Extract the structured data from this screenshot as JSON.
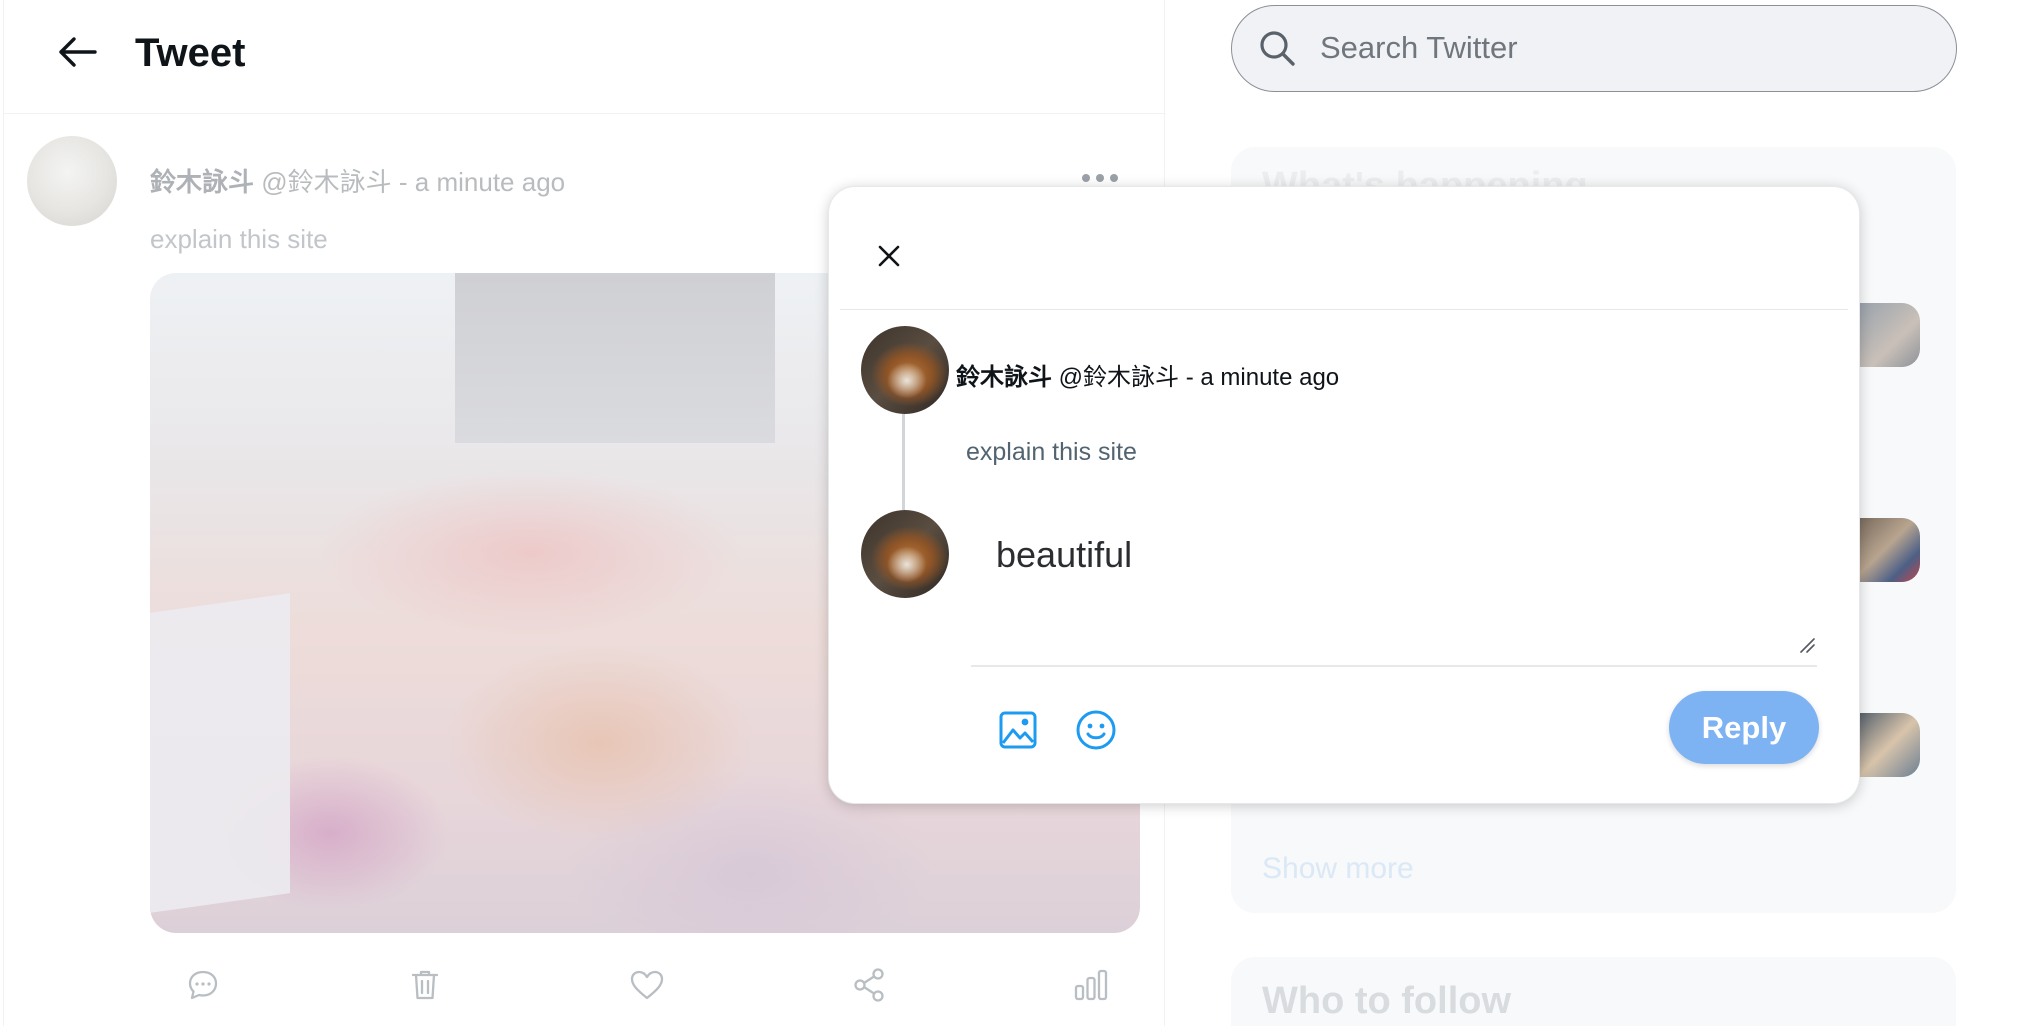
{
  "header": {
    "title": "Tweet"
  },
  "tweet": {
    "author_name": "鈴木詠斗",
    "author_handle": "@鈴木詠斗",
    "separator": "-",
    "timestamp": "a minute ago",
    "text": "explain this site",
    "actions": [
      "comment-icon",
      "trash-icon",
      "heart-icon",
      "share-icon",
      "stats-icon"
    ]
  },
  "search": {
    "placeholder": "Search Twitter"
  },
  "trends": {
    "title": "What's happening",
    "show_more": "Show more"
  },
  "follow": {
    "title": "Who to follow"
  },
  "reply_modal": {
    "original": {
      "author_name": "鈴木詠斗",
      "author_handle": "@鈴木詠斗",
      "separator": "-",
      "timestamp": "a minute ago",
      "text": "explain this site"
    },
    "reply_text": "beautiful",
    "reply_button_label": "Reply",
    "accent_color": "#1d9bf0",
    "reply_button_color": "#7db2f3"
  }
}
